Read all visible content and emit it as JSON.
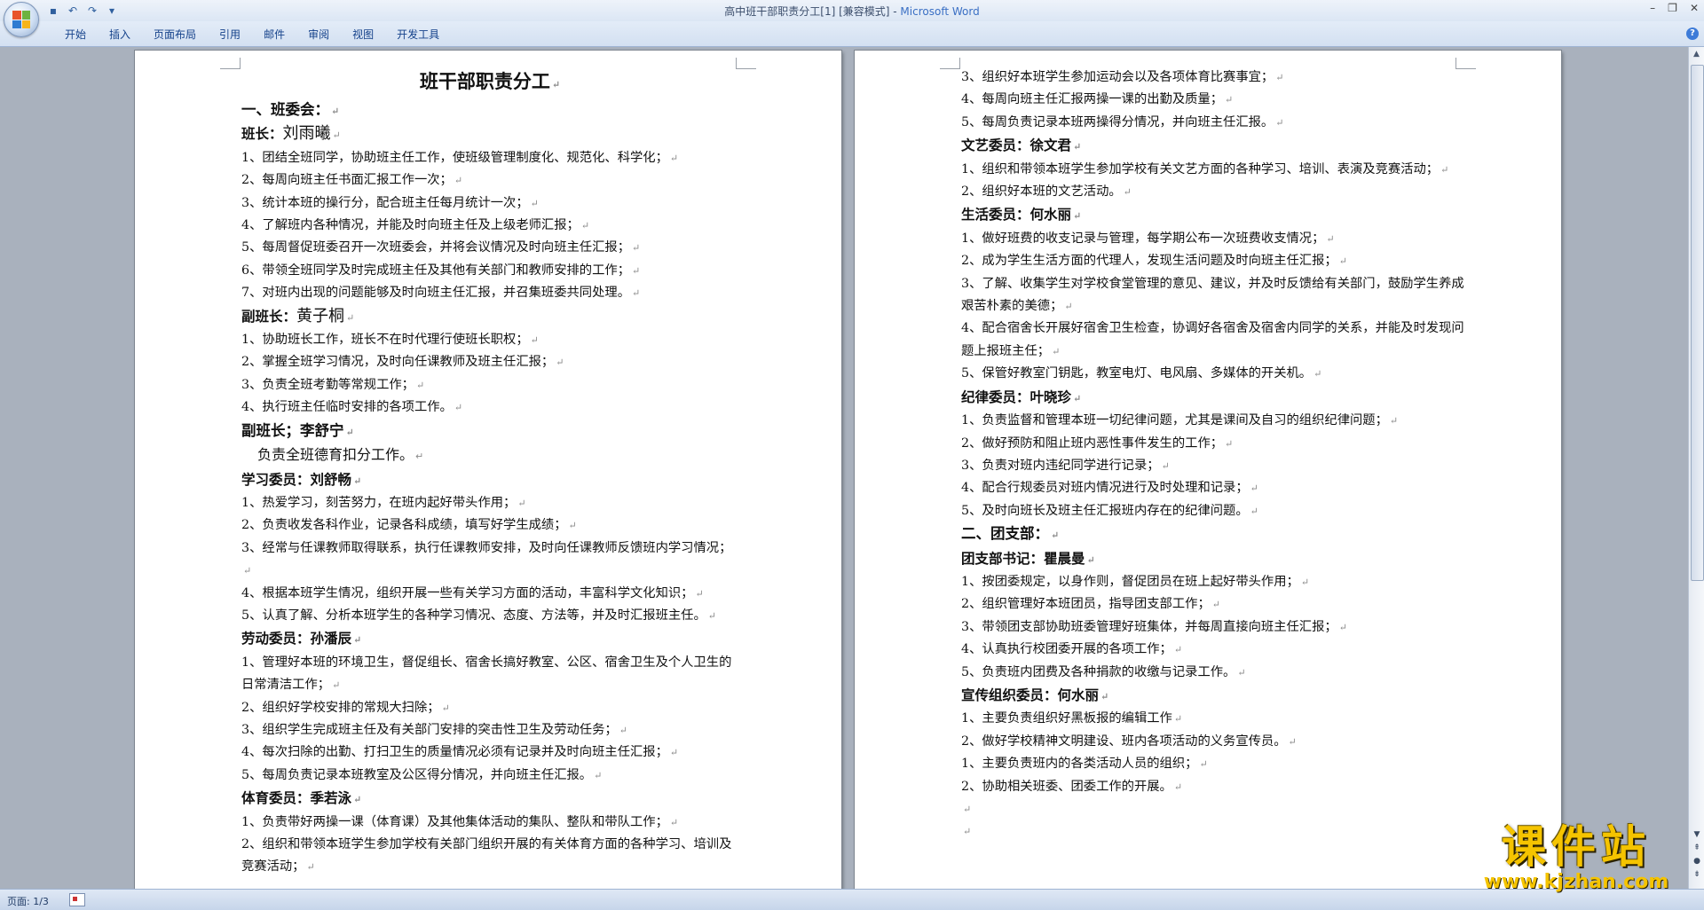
{
  "window": {
    "title": "高中班干部职责分工[1] [兼容模式] - ",
    "app": "Microsoft Word"
  },
  "qat": {
    "save_icon": "save-icon",
    "undo_icon": "undo-icon",
    "redo_icon": "redo-icon",
    "customize_icon": "chevron-down-icon"
  },
  "ribbon": {
    "tabs": [
      "开始",
      "插入",
      "页面布局",
      "引用",
      "邮件",
      "审阅",
      "视图",
      "开发工具"
    ]
  },
  "status": {
    "page": "页面: 1/3"
  },
  "watermark": {
    "text": "课件站",
    "url": "www.kjzhan.com"
  },
  "doc": {
    "title": "班干部职责分工",
    "sec1": "一、班委会：",
    "monitor_label": "班长：",
    "monitor_name": "刘雨曦",
    "monitor_items": [
      "1、团结全班同学，协助班主任工作，使班级管理制度化、规范化、科学化；",
      "2、每周向班主任书面汇报工作一次；",
      "3、统计本班的操行分，配合班主任每月统计一次；",
      "4、了解班内各种情况，并能及时向班主任及上级老师汇报；",
      "5、每周督促班委召开一次班委会，并将会议情况及时向班主任汇报；",
      "6、带领全班同学及时完成班主任及其他有关部门和教师安排的工作；",
      "7、对班内出现的问题能够及时向班主任汇报，并召集班委共同处理。"
    ],
    "vice1_label": "副班长：",
    "vice1_name": "黄子桐",
    "vice1_items": [
      "1、协助班长工作，班长不在时代理行使班长职权；",
      "2、掌握全班学习情况，及时向任课教师及班主任汇报；",
      "3、负责全班考勤等常规工作；",
      "4、执行班主任临时安排的各项工作。"
    ],
    "vice2_heading": "副班长；李舒宁",
    "vice2_text": "负责全班德育扣分工作。",
    "study_heading": "学习委员：刘舒畅",
    "study_items": [
      "1、热爱学习，刻苦努力，在班内起好带头作用；",
      "2、负责收发各科作业，记录各科成绩，填写好学生成绩；",
      "3、经常与任课教师取得联系，执行任课教师安排，及时向任课教师反馈班内学习情况；",
      "4、根据本班学生情况，组织开展一些有关学习方面的活动，丰富科学文化知识；",
      "5、认真了解、分析本班学生的各种学习情况、态度、方法等，并及时汇报班主任。"
    ],
    "labor_heading": "劳动委员：孙潘辰",
    "labor_items": [
      "1、管理好本班的环境卫生，督促组长、宿舍长搞好教室、公区、宿舍卫生及个人卫生的日常清洁工作；",
      "2、组织好学校安排的常规大扫除；",
      "3、组织学生完成班主任及有关部门安排的突击性卫生及劳动任务；",
      "4、每次扫除的出勤、打扫卫生的质量情况必须有记录并及时向班主任汇报；",
      "5、每周负责记录本班教室及公区得分情况，并向班主任汇报。"
    ],
    "pe_heading": "体育委员：季若泳",
    "pe_items_p1": [
      "1、负责带好两操一课（体育课）及其他集体活动的集队、整队和带队工作；",
      "2、组织和带领本班学生参加学校有关部门组织开展的有关体育方面的各种学习、培训及竞赛活动；"
    ],
    "pe_items_p2": [
      "3、组织好本班学生参加运动会以及各项体育比赛事宜；",
      "4、每周向班主任汇报两操一课的出勤及质量；",
      "5、每周负责记录本班两操得分情况，并向班主任汇报。"
    ],
    "arts_heading": "文艺委员：徐文君",
    "arts_items": [
      "1、组织和带领本班学生参加学校有关文艺方面的各种学习、培训、表演及竞赛活动；",
      "2、组织好本班的文艺活动。"
    ],
    "life_heading": "生活委员：何水丽",
    "life_items": [
      "1、做好班费的收支记录与管理，每学期公布一次班费收支情况；",
      "2、成为学生生活方面的代理人，发现生活问题及时向班主任汇报；",
      "3、了解、收集学生对学校食堂管理的意见、建议，并及时反馈给有关部门，鼓励学生养成艰苦朴素的美德；",
      "4、配合宿舍长开展好宿舍卫生检查，协调好各宿舍及宿舍内同学的关系，并能及时发现问题上报班主任；",
      "5、保管好教室门钥匙，教室电灯、电风扇、多媒体的开关机。"
    ],
    "discipline_heading": "纪律委员：叶晓珍",
    "discipline_items": [
      "1、负责监督和管理本班一切纪律问题，尤其是课间及自习的组织纪律问题；",
      "2、做好预防和阻止班内恶性事件发生的工作；",
      "3、负责对班内违纪同学进行记录；",
      "4、配合行规委员对班内情况进行及时处理和记录；",
      "5、及时向班长及班主任汇报班内存在的纪律问题。"
    ],
    "sec2": "二、团支部：",
    "league_heading": "团支部书记：瞿晨曼",
    "league_items": [
      "1、按团委规定，以身作则，督促团员在班上起好带头作用；",
      "2、组织管理好本班团员，指导团支部工作；",
      "3、带领团支部协助班委管理好班集体，并每周直接向班主任汇报；",
      "4、认真执行校团委开展的各项工作；",
      "5、负责班内团费及各种捐款的收缴与记录工作。"
    ],
    "publicity_heading": "宣传组织委员：何水丽",
    "publicity_items": [
      "1、主要负责组织好黑板报的编辑工作",
      "2、做好学校精神文明建设、班内各项活动的义务宣传员。",
      "1、主要负责班内的各类活动人员的组织；",
      "2、协助相关班委、团委工作的开展。"
    ]
  }
}
